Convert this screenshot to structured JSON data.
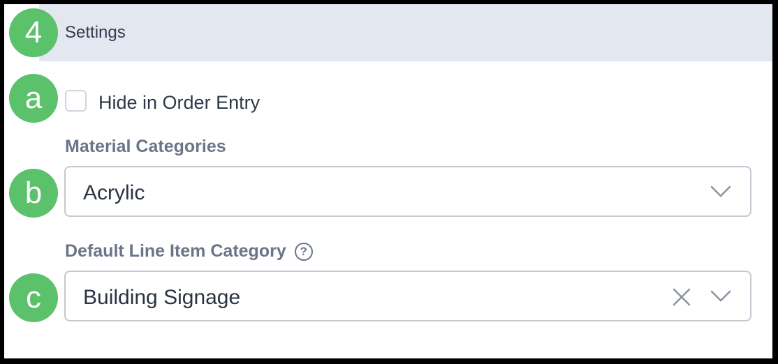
{
  "section": {
    "number": "4",
    "title": "Settings"
  },
  "steps": {
    "a": "a",
    "b": "b",
    "c": "c"
  },
  "hide_in_order_entry": {
    "label": "Hide in Order Entry",
    "checked": false
  },
  "material_categories": {
    "label": "Material Categories",
    "value": "Acrylic"
  },
  "default_line_item_category": {
    "label": "Default Line Item Category",
    "help_icon": "question-circle-icon",
    "help_glyph": "?",
    "value": "Building Signage"
  },
  "colors": {
    "badge": "#5cc16b",
    "header_bg": "#e3e7ef",
    "label_text": "#6b7588"
  }
}
